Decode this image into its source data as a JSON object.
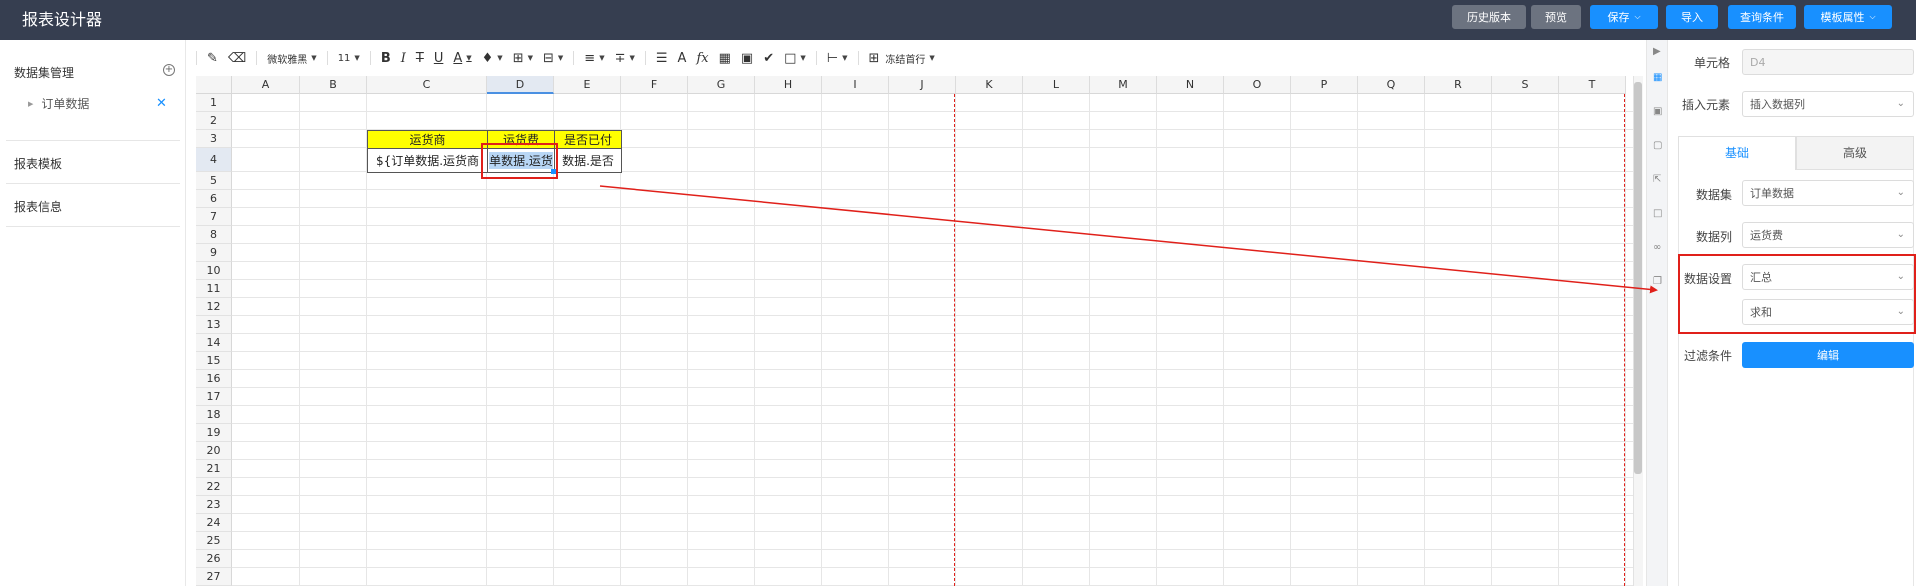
{
  "header": {
    "title": "报表设计器",
    "buttons": [
      {
        "label": "历史版本",
        "style": "grey",
        "dropdown": false
      },
      {
        "label": "预览",
        "style": "grey",
        "dropdown": false
      },
      {
        "label": "保存",
        "style": "blue",
        "dropdown": true
      },
      {
        "label": "导入",
        "style": "blue",
        "dropdown": false
      },
      {
        "label": "查询条件",
        "style": "blue",
        "dropdown": false
      },
      {
        "label": "模板属性",
        "style": "blue",
        "dropdown": true
      }
    ]
  },
  "sidebar": {
    "dataset_title": "数据集管理",
    "dataset_item": "订单数据",
    "template_title": "报表模板",
    "info_title": "报表信息"
  },
  "toolbar": {
    "font_family": "微软雅黑",
    "font_size": "11",
    "freeze_label": "冻结首行"
  },
  "sheet": {
    "columns": [
      "A",
      "B",
      "C",
      "D",
      "E",
      "F",
      "G",
      "H",
      "I",
      "J",
      "K",
      "L",
      "M",
      "N",
      "O",
      "P",
      "Q",
      "R",
      "S",
      "T"
    ],
    "rows": [
      "1",
      "2",
      "3",
      "4",
      "5",
      "6",
      "7",
      "8",
      "9",
      "10",
      "11",
      "12",
      "13",
      "14",
      "15",
      "16",
      "17",
      "18",
      "19",
      "20",
      "21",
      "22",
      "23",
      "24",
      "25",
      "26",
      "27"
    ],
    "selected_column": "D",
    "selected_row": "4",
    "cells": {
      "C3": "运货商",
      "D3": "运货费",
      "E3": "是否已付",
      "C4": "${订单数据.运货商",
      "D4": "单数据.运货",
      "E4": "数据.是否"
    }
  },
  "panel": {
    "cell_label": "单元格",
    "cell_value": "D4",
    "insert_label": "插入元素",
    "insert_value": "插入数据列",
    "tab_basic": "基础",
    "tab_advanced": "高级",
    "dataset_label": "数据集",
    "dataset_value": "订单数据",
    "column_label": "数据列",
    "column_value": "运货费",
    "data_setting_label": "数据设置",
    "data_setting_value": "汇总",
    "aggregate_value": "求和",
    "filter_label": "过滤条件",
    "edit_label": "编辑"
  },
  "colors": {
    "header_bg": "#363e50",
    "accent": "#1890ff",
    "grey_button": "#6c7380",
    "highlight_yellow": "#ffff00",
    "annotation_red": "#e0201a"
  }
}
